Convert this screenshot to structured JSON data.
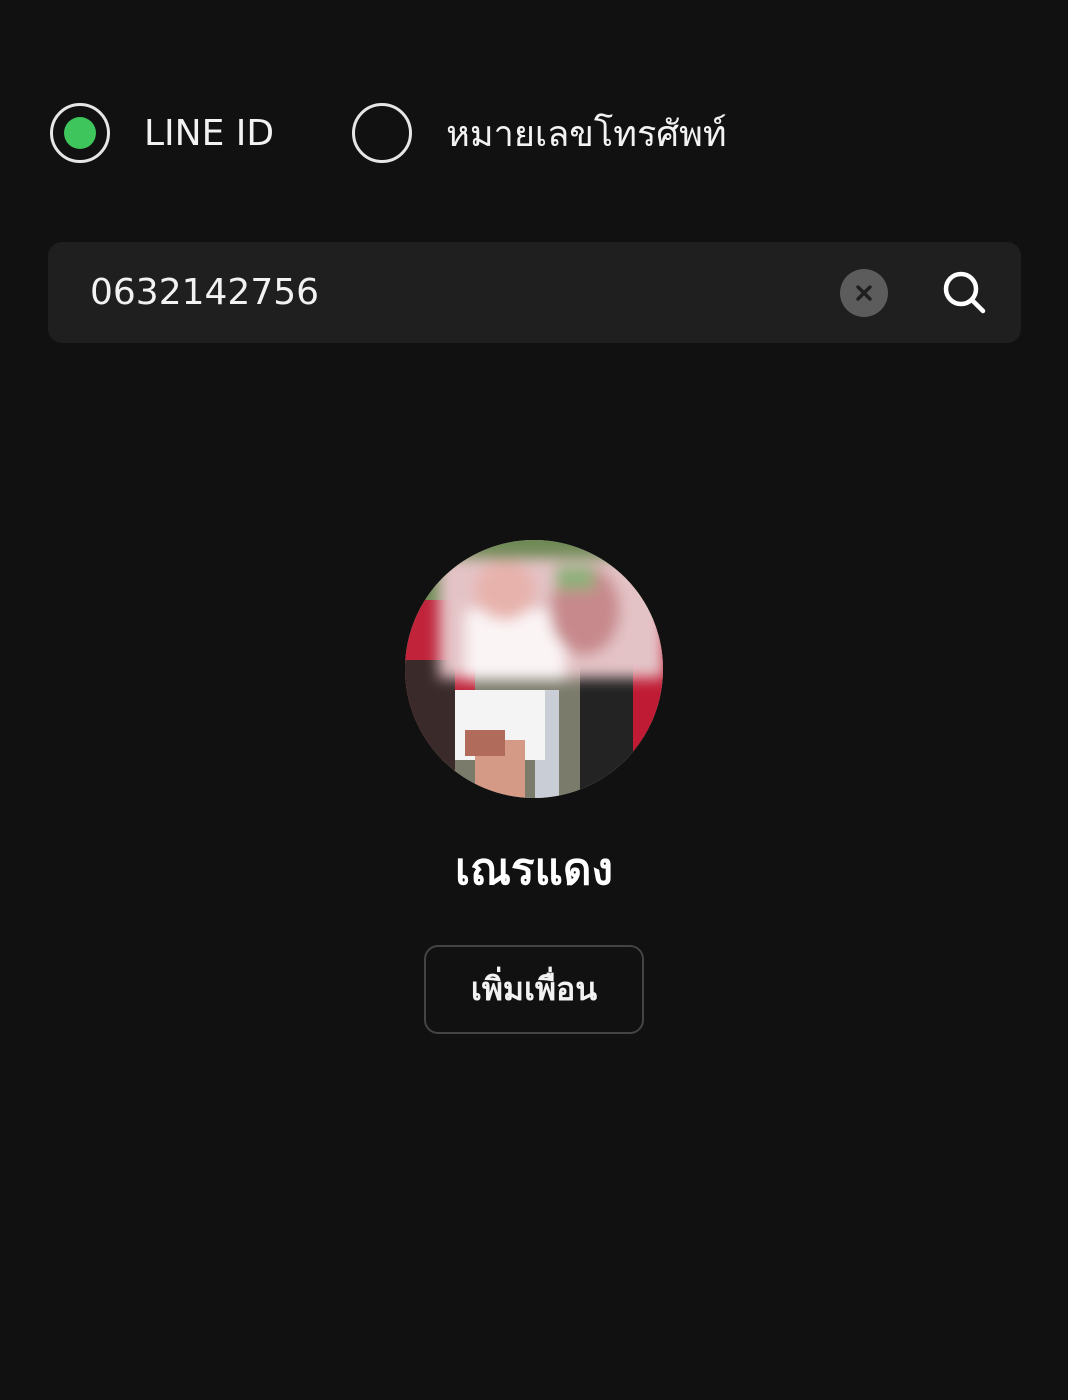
{
  "search_type": {
    "options": [
      {
        "label": "LINE ID",
        "selected": true
      },
      {
        "label": "หมายเลขโทรศัพท์",
        "selected": false
      }
    ]
  },
  "search": {
    "value": "0632142756",
    "clear_icon": "clear-icon",
    "search_icon": "search-icon"
  },
  "result": {
    "name": "เณรแดง",
    "add_button_label": "เพิ่มเพื่อน"
  },
  "colors": {
    "background": "#111111",
    "accent": "#3ec55b",
    "field": "#1f1f1f"
  }
}
